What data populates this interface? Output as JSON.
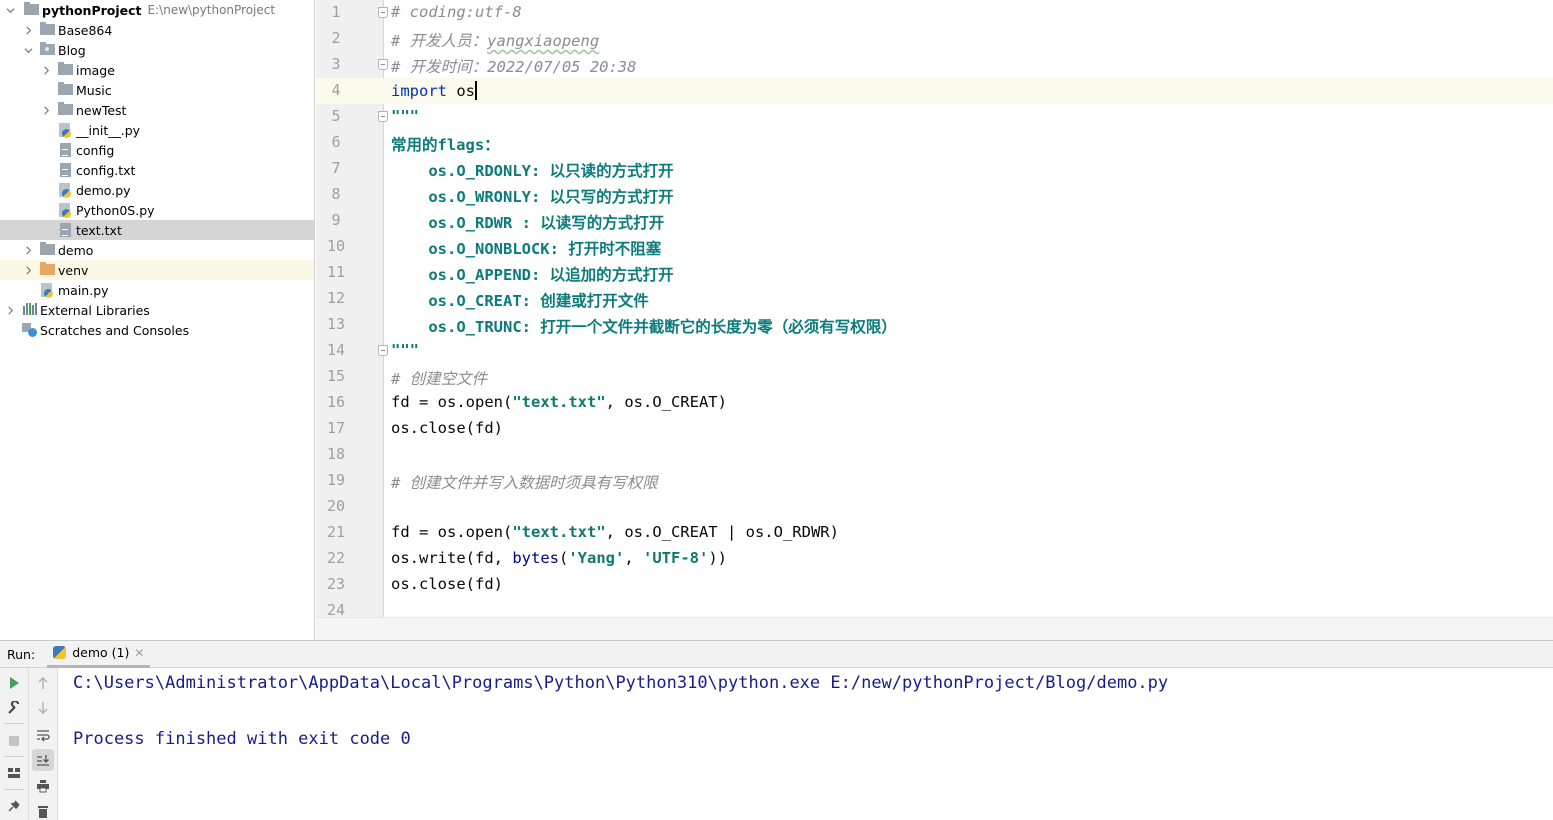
{
  "project_tree": {
    "root": {
      "label": "pythonProject",
      "path": "E:\\new\\pythonProject"
    },
    "items": [
      {
        "label": "Base864",
        "type": "folder"
      },
      {
        "label": "Blog",
        "type": "package"
      },
      {
        "label": "image",
        "type": "folder"
      },
      {
        "label": "Music",
        "type": "folder"
      },
      {
        "label": "newTest",
        "type": "folder"
      },
      {
        "label": "__init__.py",
        "type": "python"
      },
      {
        "label": "config",
        "type": "text"
      },
      {
        "label": "config.txt",
        "type": "text"
      },
      {
        "label": "demo.py",
        "type": "python"
      },
      {
        "label": "Python0S.py",
        "type": "python"
      },
      {
        "label": "text.txt",
        "type": "text",
        "selected": true
      },
      {
        "label": "demo",
        "type": "folder"
      },
      {
        "label": "venv",
        "type": "excluded-folder"
      },
      {
        "label": "main.py",
        "type": "python"
      },
      {
        "label": "External Libraries",
        "type": "libraries"
      },
      {
        "label": "Scratches and Consoles",
        "type": "scratches"
      }
    ]
  },
  "editor": {
    "current_line": 4,
    "lines": [
      {
        "n": "1",
        "segments": [
          {
            "t": "# coding:utf-8",
            "c": "comment"
          }
        ]
      },
      {
        "n": "2",
        "segments": [
          {
            "t": "# 开发人员：",
            "c": "comment"
          },
          {
            "t": "yangxiaopeng",
            "c": "comment squiggle"
          }
        ]
      },
      {
        "n": "3",
        "segments": [
          {
            "t": "# 开发时间：2022/07/05 20:38",
            "c": "comment"
          }
        ]
      },
      {
        "n": "4",
        "segments": [
          {
            "t": "import",
            "c": "kw"
          },
          {
            "t": " os",
            "c": ""
          }
        ]
      },
      {
        "n": "5",
        "segments": [
          {
            "t": "\"\"\"",
            "c": "docstr"
          }
        ]
      },
      {
        "n": "6",
        "segments": [
          {
            "t": "常用的flags：",
            "c": "docstr"
          }
        ]
      },
      {
        "n": "7",
        "segments": [
          {
            "t": "    os.O_RDONLY: 以只读的方式打开",
            "c": "docstr"
          }
        ]
      },
      {
        "n": "8",
        "segments": [
          {
            "t": "    os.O_WRONLY: 以只写的方式打开",
            "c": "docstr"
          }
        ]
      },
      {
        "n": "9",
        "segments": [
          {
            "t": "    os.O_RDWR : 以读写的方式打开",
            "c": "docstr"
          }
        ]
      },
      {
        "n": "10",
        "segments": [
          {
            "t": "    os.O_NONBLOCK: 打开时不阻塞",
            "c": "docstr"
          }
        ]
      },
      {
        "n": "11",
        "segments": [
          {
            "t": "    os.O_APPEND: 以追加的方式打开",
            "c": "docstr"
          }
        ]
      },
      {
        "n": "12",
        "segments": [
          {
            "t": "    os.O_CREAT: 创建或打开文件",
            "c": "docstr"
          }
        ]
      },
      {
        "n": "13",
        "segments": [
          {
            "t": "    os.O_TRUNC: 打开一个文件并截断它的长度为零（必须有写权限）",
            "c": "docstr"
          }
        ]
      },
      {
        "n": "14",
        "segments": [
          {
            "t": "\"\"\"",
            "c": "docstr"
          }
        ]
      },
      {
        "n": "15",
        "segments": [
          {
            "t": "# 创建空文件",
            "c": "comment"
          }
        ]
      },
      {
        "n": "16",
        "segments": [
          {
            "t": "fd = os.open(",
            "c": ""
          },
          {
            "t": "\"text.txt\"",
            "c": "strg"
          },
          {
            "t": ", os.O_CREAT)",
            "c": ""
          }
        ]
      },
      {
        "n": "17",
        "segments": [
          {
            "t": "os.close(fd)",
            "c": ""
          }
        ]
      },
      {
        "n": "18",
        "segments": []
      },
      {
        "n": "19",
        "segments": [
          {
            "t": "# 创建文件并写入数据时须具有写权限",
            "c": "comment"
          }
        ]
      },
      {
        "n": "20",
        "segments": []
      },
      {
        "n": "21",
        "segments": [
          {
            "t": "fd = os.open(",
            "c": ""
          },
          {
            "t": "\"text.txt\"",
            "c": "strg"
          },
          {
            "t": ", os.O_CREAT | os.O_RDWR)",
            "c": ""
          }
        ]
      },
      {
        "n": "22",
        "segments": [
          {
            "t": "os.write(fd, ",
            "c": ""
          },
          {
            "t": "bytes",
            "c": "builtin"
          },
          {
            "t": "(",
            "c": ""
          },
          {
            "t": "'Yang'",
            "c": "strg"
          },
          {
            "t": ", ",
            "c": ""
          },
          {
            "t": "'UTF-8'",
            "c": "strg"
          },
          {
            "t": "))",
            "c": ""
          }
        ]
      },
      {
        "n": "23",
        "segments": [
          {
            "t": "os.close(fd)",
            "c": ""
          }
        ]
      },
      {
        "n": "24",
        "segments": []
      }
    ]
  },
  "run_panel": {
    "label": "Run:",
    "tab_label": "demo (1)",
    "console_lines": [
      "C:\\Users\\Administrator\\AppData\\Local\\Programs\\Python\\Python310\\python.exe E:/new/pythonProject/Blog/demo.py",
      "",
      "Process finished with exit code 0"
    ]
  }
}
